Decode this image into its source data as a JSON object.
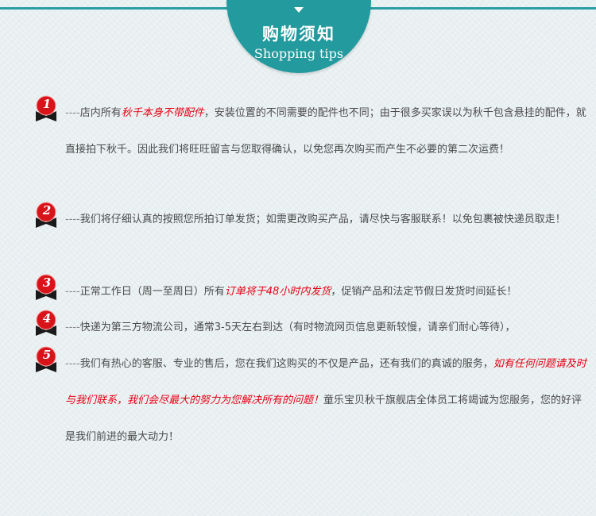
{
  "header": {
    "title": "购物须知",
    "subtitle": "Shopping tips"
  },
  "colors": {
    "accent": "#229a9e",
    "highlight": "#e60012",
    "badge_red": "#d8141b",
    "badge_ribbon": "#1a1a1a"
  },
  "items": [
    {
      "number": "1",
      "dash": "----",
      "part1": "店内所有",
      "highlight1": "秋千本身不带配件",
      "part2": "，安装位置的不同需要的配件也不同；由于很多买家误以为秋千包含悬挂的配件，就直接拍下秋千。因此我们将旺旺留言与您取得确认，以免您再次购买而产生不必要的第二次运费！"
    },
    {
      "number": "2",
      "dash": "----",
      "part1": "我们将仔细认真的按照您所拍订单发货；如需更改购买产品，请尽快与客服联系！以免包裹被快递员取走！"
    },
    {
      "number": "3",
      "dash": "----",
      "part1": "正常工作日（周一至周日）所有",
      "highlight1": "订单将于48小时内发货",
      "part2": "，促销产品和法定节假日发货时间延长！"
    },
    {
      "number": "4",
      "dash": "----",
      "part1": "快递为第三方物流公司，通常3-5天左右到达（有时物流网页信息更新较慢，请亲们耐心等待），"
    },
    {
      "number": "5",
      "dash": "----",
      "part1": "我们有热心的客服、专业的售后，您在我们这购买的不仅是产品，还有我们的真诚的服务，",
      "highlight1": "如有任何问题请及时与我们联系，我们会尽最大的努力为您解决所有的问题！",
      "part2": "童乐宝贝秋千旗舰店全体员工将竭诚为您服务，您的好评是我们前进的最大动力！"
    }
  ]
}
